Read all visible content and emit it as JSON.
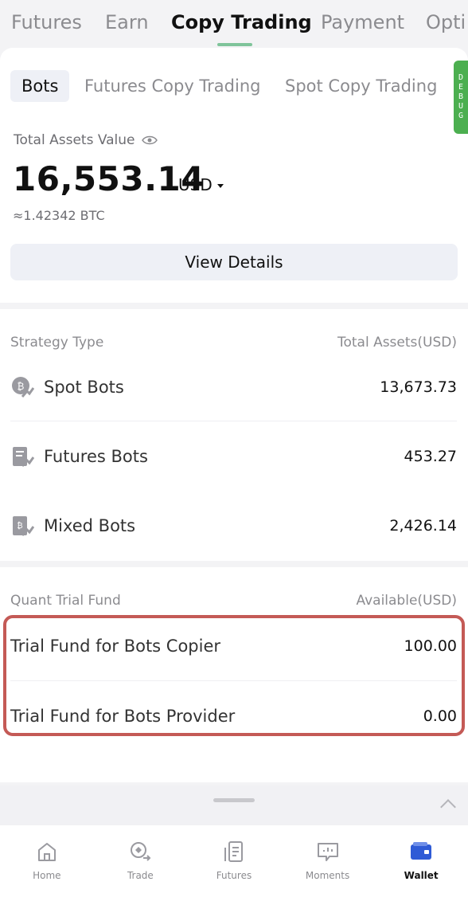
{
  "top_tabs": [
    {
      "label": "Futures"
    },
    {
      "label": "Earn"
    },
    {
      "label": "Copy Trading"
    },
    {
      "label": "Payment"
    },
    {
      "label": "Opti"
    }
  ],
  "sub_tabs": [
    {
      "label": "Bots"
    },
    {
      "label": "Futures Copy Trading"
    },
    {
      "label": "Spot Copy Trading"
    }
  ],
  "debug_badge": "DEBUG",
  "assets": {
    "label": "Total Assets Value",
    "value": "16,553.14",
    "currency": "USD",
    "btc_equivalent": "≈1.42342 BTC",
    "view_details_label": "View Details"
  },
  "strategy": {
    "header_left": "Strategy Type",
    "header_right": "Total Assets(USD)",
    "rows": [
      {
        "label": "Spot Bots",
        "value": "13,673.73",
        "icon": "spot-bots-icon"
      },
      {
        "label": "Futures Bots",
        "value": "453.27",
        "icon": "futures-bots-icon"
      },
      {
        "label": "Mixed Bots",
        "value": "2,426.14",
        "icon": "mixed-bots-icon"
      }
    ]
  },
  "trial": {
    "header_left": "Quant Trial Fund",
    "header_right": "Available(USD)",
    "rows": [
      {
        "label": "Trial Fund for Bots Copier",
        "value": "100.00"
      },
      {
        "label": "Trial Fund for Bots Provider",
        "value": "0.00"
      }
    ],
    "highlight_color": "#c45a56"
  },
  "bottom_nav": [
    {
      "label": "Home",
      "icon": "home-icon"
    },
    {
      "label": "Trade",
      "icon": "trade-icon"
    },
    {
      "label": "Futures",
      "icon": "futures-icon"
    },
    {
      "label": "Moments",
      "icon": "moments-icon"
    },
    {
      "label": "Wallet",
      "icon": "wallet-icon"
    }
  ],
  "colors": {
    "accent_green": "#7fc49a",
    "wallet_blue": "#2f5bd6",
    "debug_green": "#4caf50"
  }
}
